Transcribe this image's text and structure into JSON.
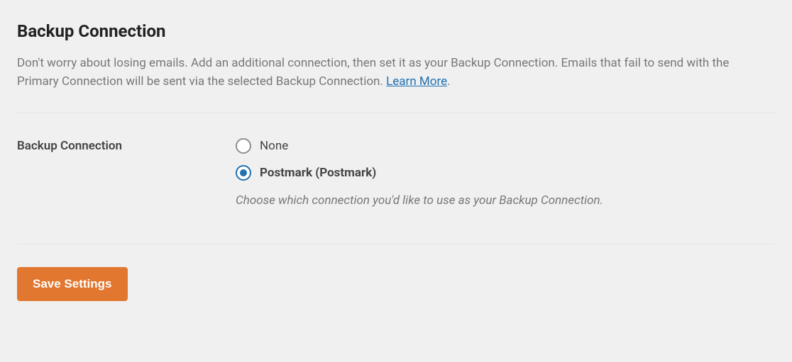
{
  "section": {
    "title": "Backup Connection",
    "description_part1": "Don't worry about losing emails. Add an additional connection, then set it as your Backup Connection. Emails that fail to send with the Primary Connection will be sent via the selected Backup Connection. ",
    "learn_more_label": "Learn More",
    "description_end": "."
  },
  "field": {
    "label": "Backup Connection",
    "options": {
      "none": "None",
      "postmark": "Postmark (Postmark)"
    },
    "hint": "Choose which connection you'd like to use as your Backup Connection."
  },
  "actions": {
    "save_label": "Save Settings"
  }
}
